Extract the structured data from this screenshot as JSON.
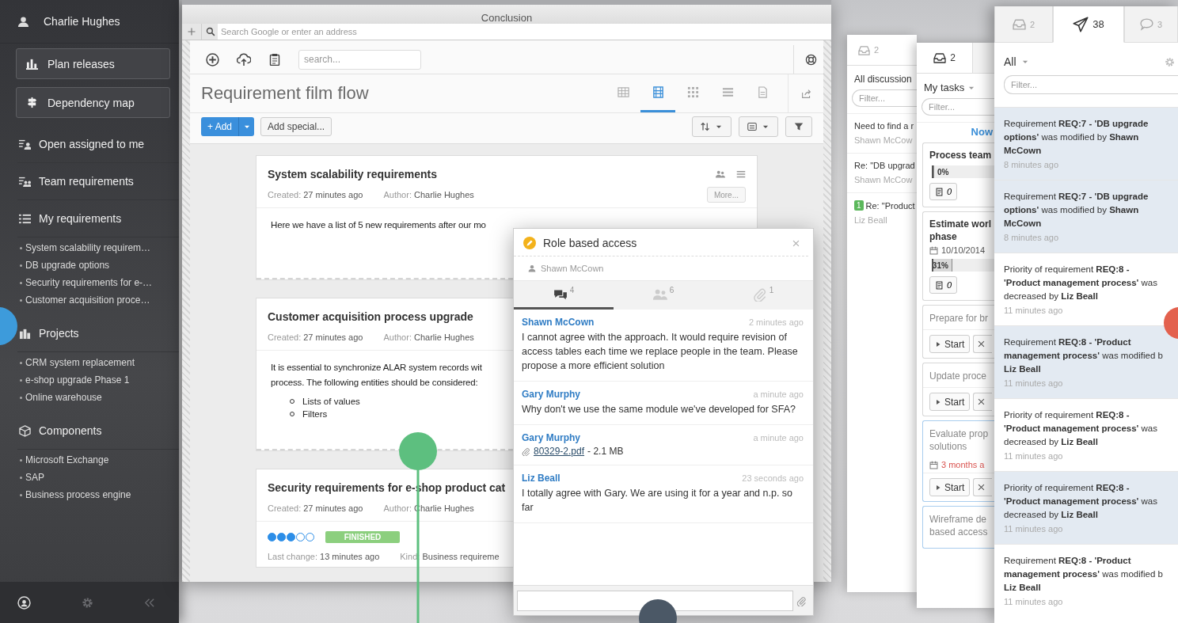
{
  "sidebar": {
    "user": "Charlie Hughes",
    "buttons": [
      {
        "label": "Plan releases"
      },
      {
        "label": "Dependency map"
      }
    ],
    "sections": [
      {
        "title": "Open assigned to me"
      },
      {
        "title": "Team requirements"
      },
      {
        "title": "My requirements",
        "items": [
          "System scalability requirem…",
          "DB upgrade options",
          "Security requirements for e-…",
          "Customer acquisition proce…"
        ]
      },
      {
        "title": "Projects",
        "items": [
          "CRM system replacement",
          "e-shop upgrade Phase 1",
          "Online warehouse"
        ]
      },
      {
        "title": "Components",
        "items": [
          "Microsoft Exchange",
          "SAP",
          "Business process engine"
        ]
      }
    ]
  },
  "browser": {
    "title": "Conclusion",
    "address_placeholder": "Search Google or enter an address"
  },
  "app": {
    "search_placeholder": "search...",
    "title": "Requirement film flow",
    "views": [
      {
        "selected": false
      },
      {
        "selected": true
      },
      {
        "selected": false
      },
      {
        "selected": false
      },
      {
        "selected": false
      }
    ],
    "add_label": "+ Add",
    "add_special": "Add special..."
  },
  "cards": [
    {
      "title": "System scalability requirements",
      "meta": [
        {
          "label": "Created:",
          "value": "27 minutes ago"
        },
        {
          "label": "Author:",
          "value": "Charlie Hughes"
        }
      ],
      "more": "More...",
      "body": "Here we have a list of 5 new requirements after our mo"
    },
    {
      "title": "Customer acquisition process upgrade",
      "meta": [
        {
          "label": "Created:",
          "value": "27 minutes ago"
        },
        {
          "label": "Author:",
          "value": "Charlie Hughes"
        }
      ],
      "body": "It is essential to synchronize ALAR system records wit\nprocess. The following entities should be considered:",
      "list": [
        "Lists of values",
        "Filters"
      ]
    },
    {
      "title": "Security requirements for e-shop product cat",
      "meta": [
        {
          "label": "Created:",
          "value": "27 minutes ago"
        },
        {
          "label": "Author:",
          "value": "Charlie Hughes"
        }
      ],
      "stars": 3,
      "status": "FINISHED",
      "footer_meta": [
        {
          "label": "Last change:",
          "value": "13 minutes ago"
        },
        {
          "label": "Kind:",
          "value": "Business requireme"
        }
      ]
    }
  ],
  "dialog": {
    "title": "Role based access",
    "owner": "Shawn McCown",
    "tabs": [
      {
        "count": "4",
        "selected": true
      },
      {
        "count": "6",
        "selected": false
      },
      {
        "count": "1",
        "selected": false
      }
    ],
    "comments": [
      {
        "author": "Shawn McCown",
        "time": "2 minutes ago",
        "text": "I cannot agree with the approach. It would require revision of access tables each time we replace people in the team. Please propose a more efficient solution"
      },
      {
        "author": "Gary Murphy",
        "time": "a minute ago",
        "text": "Why don't we use the same module we've developed for SFA?"
      },
      {
        "author": "Gary Murphy",
        "time": "a minute ago",
        "attachment": {
          "file": "80329-2.pdf",
          "size": "- 2.1 MB"
        }
      },
      {
        "author": "Liz Beall",
        "time": "23 seconds ago",
        "text": "I totally agree with Gary. We are using it for a year and n.p. so far"
      }
    ]
  },
  "discussions": {
    "tab_count": "2",
    "title": "All discussion",
    "filter_placeholder": "Filter...",
    "items": [
      {
        "title": "Need to find a r",
        "author": "Shawn McCow"
      },
      {
        "title": "Re: \"DB upgrad",
        "author": "Shawn McCow"
      },
      {
        "badge": "1",
        "title": "Re: \"Product",
        "author": "Liz Beall"
      }
    ]
  },
  "tasks": {
    "tab_count": "2",
    "title": "My tasks",
    "filter_placeholder": "Filter...",
    "group": "Now",
    "items": [
      {
        "kind": "progress",
        "title": "Process team",
        "level": 0,
        "reading": "0%",
        "notes": "0"
      },
      {
        "kind": "progress",
        "title": "Estimate worl\nphase",
        "date": "10/10/2014",
        "overdue": false,
        "level": 0.31,
        "reading": "31%",
        "notes": "0"
      },
      {
        "kind": "action",
        "title": "Prepare for br",
        "start": "Start",
        "selected": false
      },
      {
        "kind": "action",
        "title": "Update proce",
        "start": "Start",
        "selected": false
      },
      {
        "kind": "action",
        "title": "Evaluate prop\nsolutions",
        "date": "3 months a",
        "overdue": true,
        "start": "Start",
        "selected": true
      },
      {
        "kind": "action",
        "title": "Wireframe de\nbased access",
        "selected": true
      }
    ]
  },
  "notifications": {
    "tabs": [
      {
        "count": "2",
        "selected": false
      },
      {
        "count": "38",
        "selected": true
      },
      {
        "count": "3",
        "selected": false
      }
    ],
    "scope": "All",
    "filter_placeholder": "Filter...",
    "items": [
      {
        "text": "Requirement **REQ:7 - 'DB upgrade**\n**options'** was modified by **Shawn**\n**McCown**",
        "time": "8 minutes ago",
        "unread": true
      },
      {
        "text": "Requirement **REQ:7 - 'DB upgrade**\n**options'** was modified by **Shawn**\n**McCown**",
        "time": "8 minutes ago",
        "unread": true
      },
      {
        "text": "Priority of requirement **REQ:8 -**\n**'Product management process'** was\ndecreased by **Liz Beall**",
        "time": "11 minutes ago",
        "unread": false
      },
      {
        "text": "Requirement **REQ:8 - 'Product**\n**management process'** was modified b\n**Liz Beall**",
        "time": "11 minutes ago",
        "unread": true
      },
      {
        "text": "Priority of requirement **REQ:8 -**\n**'Product management process'** was\ndecreased by **Liz Beall**",
        "time": "11 minutes ago",
        "unread": false
      },
      {
        "text": "Priority of requirement **REQ:8 -**\n**'Product management process'** was\ndecreased by **Liz Beall**",
        "time": "11 minutes ago",
        "unread": true
      },
      {
        "text": "Requirement **REQ:8 - 'Product**\n**management process'** was modified b\n**Liz Beall**",
        "time": "11 minutes ago",
        "unread": false
      }
    ]
  }
}
